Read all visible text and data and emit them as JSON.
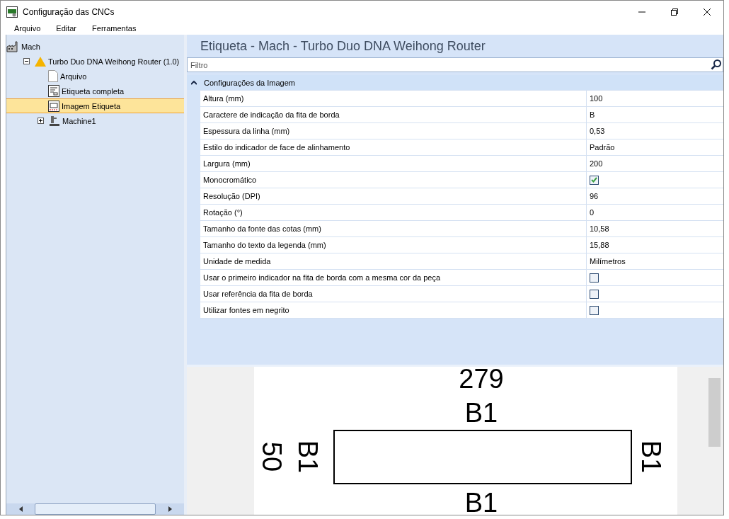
{
  "window": {
    "title": "Configuração das CNCs"
  },
  "menu": [
    "Arquivo",
    "Editar",
    "Ferramentas"
  ],
  "tree": [
    {
      "label": "Mach",
      "kind": "group",
      "selected": false,
      "children": [
        {
          "label": "Turbo Duo DNA Weihong Router (1.0)",
          "kind": "config",
          "expanded": true,
          "selected": false,
          "children": [
            {
              "label": "Arquivo",
              "kind": "file",
              "selected": false
            },
            {
              "label": "Etiqueta completa",
              "kind": "label",
              "selected": false
            },
            {
              "label": "Imagem Etiqueta",
              "kind": "image",
              "selected": true
            },
            {
              "label": "Machine1",
              "kind": "machine",
              "expanded": false,
              "selected": false
            }
          ]
        }
      ]
    }
  ],
  "panel": {
    "title": "Etiqueta - Mach - Turbo Duo DNA Weihong Router",
    "filter": {
      "placeholder": "Filtro"
    },
    "group": {
      "label": "Configurações da Imagem",
      "expanded": true
    },
    "properties": [
      {
        "name": "Altura (mm)",
        "kind": "text",
        "value": "100"
      },
      {
        "name": "Caractere de indicação da fita de borda",
        "kind": "text",
        "value": "B"
      },
      {
        "name": "Espessura da linha (mm)",
        "kind": "text",
        "value": "0,53"
      },
      {
        "name": "Estilo do indicador de face de alinhamento",
        "kind": "text",
        "value": "Padrão"
      },
      {
        "name": "Largura (mm)",
        "kind": "text",
        "value": "200"
      },
      {
        "name": "Monocromático",
        "kind": "checkbox",
        "checked": true
      },
      {
        "name": "Resolução (DPI)",
        "kind": "text",
        "value": "96"
      },
      {
        "name": "Rotação (°)",
        "kind": "text",
        "value": "0"
      },
      {
        "name": "Tamanho da fonte das cotas (mm)",
        "kind": "text",
        "value": "10,58"
      },
      {
        "name": "Tamanho do texto da legenda (mm)",
        "kind": "text",
        "value": "15,88"
      },
      {
        "name": "Unidade de medida",
        "kind": "text",
        "value": "Milímetros"
      },
      {
        "name": "Usar o primeiro indicador na fita de borda com a mesma cor da peça",
        "kind": "checkbox",
        "checked": false
      },
      {
        "name": "Usar referência da fita de borda",
        "kind": "checkbox",
        "checked": false
      },
      {
        "name": "Utilizar fontes em negrito",
        "kind": "checkbox",
        "checked": false
      }
    ]
  },
  "preview": {
    "labels": [
      {
        "text": "279"
      },
      {
        "text": "B1"
      },
      {
        "text": "50"
      },
      {
        "text": "B1"
      },
      {
        "text": "B1"
      },
      {
        "text": "B1"
      }
    ]
  }
}
